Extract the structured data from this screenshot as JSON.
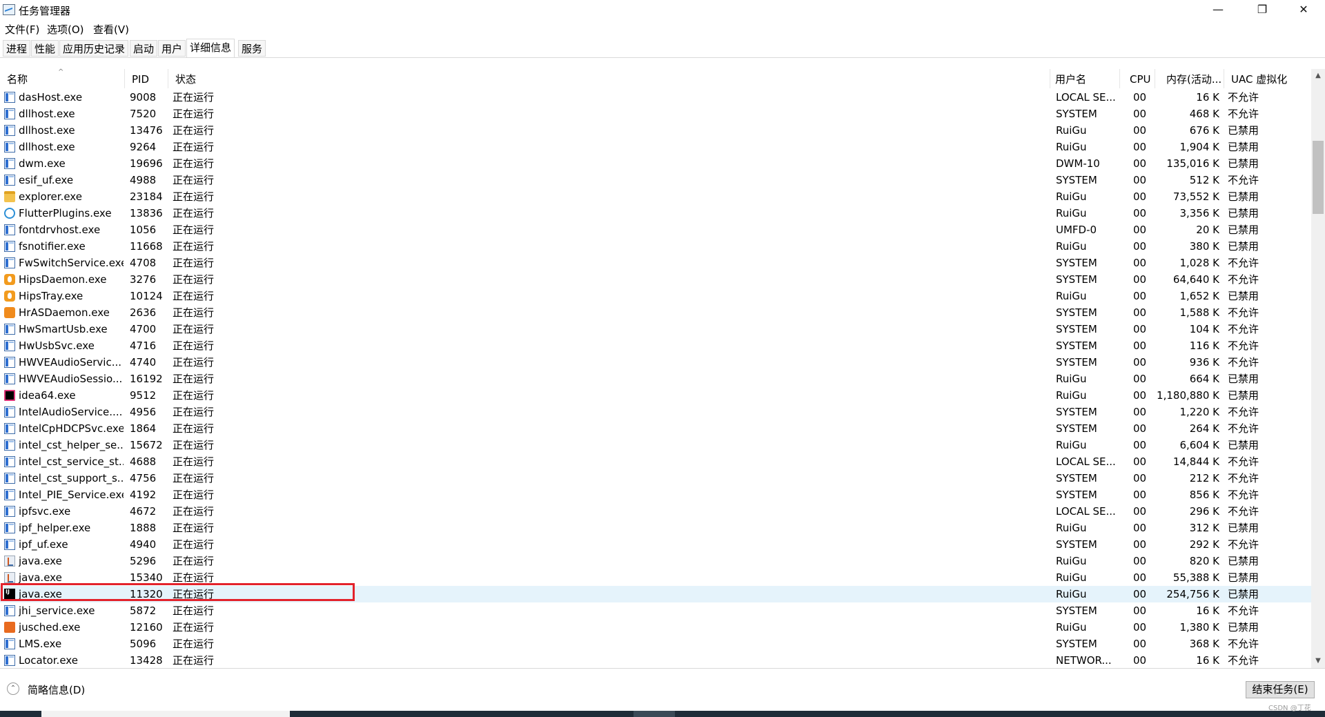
{
  "window": {
    "title": "任务管理器",
    "minimize": "—",
    "maximize": "❐",
    "close": "✕"
  },
  "menu": [
    "文件(F)",
    "选项(O)",
    "查看(V)"
  ],
  "tabs": [
    "进程",
    "性能",
    "应用历史记录",
    "启动",
    "用户",
    "详细信息",
    "服务"
  ],
  "active_tab": "详细信息",
  "columns": {
    "name": "名称",
    "pid": "PID",
    "status": "状态",
    "user": "用户名",
    "cpu": "CPU",
    "mem": "内存(活动...",
    "uac": "UAC 虚拟化"
  },
  "rows": [
    {
      "icon": "default",
      "name": "dasHost.exe",
      "pid": "9008",
      "status": "正在运行",
      "user": "LOCAL SE...",
      "cpu": "00",
      "mem": "16 K",
      "uac": "不允许"
    },
    {
      "icon": "default",
      "name": "dllhost.exe",
      "pid": "7520",
      "status": "正在运行",
      "user": "SYSTEM",
      "cpu": "00",
      "mem": "468 K",
      "uac": "不允许"
    },
    {
      "icon": "default",
      "name": "dllhost.exe",
      "pid": "13476",
      "status": "正在运行",
      "user": "RuiGu",
      "cpu": "00",
      "mem": "676 K",
      "uac": "已禁用"
    },
    {
      "icon": "default",
      "name": "dllhost.exe",
      "pid": "9264",
      "status": "正在运行",
      "user": "RuiGu",
      "cpu": "00",
      "mem": "1,904 K",
      "uac": "已禁用"
    },
    {
      "icon": "default",
      "name": "dwm.exe",
      "pid": "19696",
      "status": "正在运行",
      "user": "DWM-10",
      "cpu": "00",
      "mem": "135,016 K",
      "uac": "已禁用"
    },
    {
      "icon": "default",
      "name": "esif_uf.exe",
      "pid": "4988",
      "status": "正在运行",
      "user": "SYSTEM",
      "cpu": "00",
      "mem": "512 K",
      "uac": "不允许"
    },
    {
      "icon": "folder",
      "name": "explorer.exe",
      "pid": "23184",
      "status": "正在运行",
      "user": "RuiGu",
      "cpu": "00",
      "mem": "73,552 K",
      "uac": "已禁用"
    },
    {
      "icon": "flutter",
      "name": "FlutterPlugins.exe",
      "pid": "13836",
      "status": "正在运行",
      "user": "RuiGu",
      "cpu": "00",
      "mem": "3,356 K",
      "uac": "已禁用"
    },
    {
      "icon": "default",
      "name": "fontdrvhost.exe",
      "pid": "1056",
      "status": "正在运行",
      "user": "UMFD-0",
      "cpu": "00",
      "mem": "20 K",
      "uac": "已禁用"
    },
    {
      "icon": "default",
      "name": "fsnotifier.exe",
      "pid": "11668",
      "status": "正在运行",
      "user": "RuiGu",
      "cpu": "00",
      "mem": "380 K",
      "uac": "已禁用"
    },
    {
      "icon": "default",
      "name": "FwSwitchService.exe",
      "pid": "4708",
      "status": "正在运行",
      "user": "SYSTEM",
      "cpu": "00",
      "mem": "1,028 K",
      "uac": "不允许"
    },
    {
      "icon": "flame",
      "name": "HipsDaemon.exe",
      "pid": "3276",
      "status": "正在运行",
      "user": "SYSTEM",
      "cpu": "00",
      "mem": "64,640 K",
      "uac": "不允许"
    },
    {
      "icon": "flame",
      "name": "HipsTray.exe",
      "pid": "10124",
      "status": "正在运行",
      "user": "RuiGu",
      "cpu": "00",
      "mem": "1,652 K",
      "uac": "已禁用"
    },
    {
      "icon": "orange",
      "name": "HrASDaemon.exe",
      "pid": "2636",
      "status": "正在运行",
      "user": "SYSTEM",
      "cpu": "00",
      "mem": "1,588 K",
      "uac": "不允许"
    },
    {
      "icon": "default",
      "name": "HwSmartUsb.exe",
      "pid": "4700",
      "status": "正在运行",
      "user": "SYSTEM",
      "cpu": "00",
      "mem": "104 K",
      "uac": "不允许"
    },
    {
      "icon": "default",
      "name": "HwUsbSvc.exe",
      "pid": "4716",
      "status": "正在运行",
      "user": "SYSTEM",
      "cpu": "00",
      "mem": "116 K",
      "uac": "不允许"
    },
    {
      "icon": "default",
      "name": "HWVEAudioServic...",
      "pid": "4740",
      "status": "正在运行",
      "user": "SYSTEM",
      "cpu": "00",
      "mem": "936 K",
      "uac": "不允许"
    },
    {
      "icon": "default",
      "name": "HWVEAudioSessio...",
      "pid": "16192",
      "status": "正在运行",
      "user": "RuiGu",
      "cpu": "00",
      "mem": "664 K",
      "uac": "已禁用"
    },
    {
      "icon": "idea",
      "name": "idea64.exe",
      "pid": "9512",
      "status": "正在运行",
      "user": "RuiGu",
      "cpu": "00",
      "mem": "1,180,880 K",
      "uac": "已禁用"
    },
    {
      "icon": "default",
      "name": "IntelAudioService....",
      "pid": "4956",
      "status": "正在运行",
      "user": "SYSTEM",
      "cpu": "00",
      "mem": "1,220 K",
      "uac": "不允许"
    },
    {
      "icon": "default",
      "name": "IntelCpHDCPSvc.exe",
      "pid": "1864",
      "status": "正在运行",
      "user": "SYSTEM",
      "cpu": "00",
      "mem": "264 K",
      "uac": "不允许"
    },
    {
      "icon": "default",
      "name": "intel_cst_helper_se...",
      "pid": "15672",
      "status": "正在运行",
      "user": "RuiGu",
      "cpu": "00",
      "mem": "6,604 K",
      "uac": "已禁用"
    },
    {
      "icon": "default",
      "name": "intel_cst_service_st...",
      "pid": "4688",
      "status": "正在运行",
      "user": "LOCAL SE...",
      "cpu": "00",
      "mem": "14,844 K",
      "uac": "不允许"
    },
    {
      "icon": "default",
      "name": "intel_cst_support_s...",
      "pid": "4756",
      "status": "正在运行",
      "user": "SYSTEM",
      "cpu": "00",
      "mem": "212 K",
      "uac": "不允许"
    },
    {
      "icon": "default",
      "name": "Intel_PIE_Service.exe",
      "pid": "4192",
      "status": "正在运行",
      "user": "SYSTEM",
      "cpu": "00",
      "mem": "856 K",
      "uac": "不允许"
    },
    {
      "icon": "default",
      "name": "ipfsvc.exe",
      "pid": "4672",
      "status": "正在运行",
      "user": "LOCAL SE...",
      "cpu": "00",
      "mem": "296 K",
      "uac": "不允许"
    },
    {
      "icon": "default",
      "name": "ipf_helper.exe",
      "pid": "1888",
      "status": "正在运行",
      "user": "RuiGu",
      "cpu": "00",
      "mem": "312 K",
      "uac": "已禁用"
    },
    {
      "icon": "default",
      "name": "ipf_uf.exe",
      "pid": "4940",
      "status": "正在运行",
      "user": "SYSTEM",
      "cpu": "00",
      "mem": "292 K",
      "uac": "不允许"
    },
    {
      "icon": "java",
      "name": "java.exe",
      "pid": "5296",
      "status": "正在运行",
      "user": "RuiGu",
      "cpu": "00",
      "mem": "820 K",
      "uac": "已禁用"
    },
    {
      "icon": "java",
      "name": "java.exe",
      "pid": "15340",
      "status": "正在运行",
      "user": "RuiGu",
      "cpu": "00",
      "mem": "55,388 K",
      "uac": "已禁用"
    },
    {
      "icon": "intellij",
      "name": "java.exe",
      "pid": "11320",
      "status": "正在运行",
      "user": "RuiGu",
      "cpu": "00",
      "mem": "254,756 K",
      "uac": "已禁用",
      "selected": true
    },
    {
      "icon": "default",
      "name": "jhi_service.exe",
      "pid": "5872",
      "status": "正在运行",
      "user": "SYSTEM",
      "cpu": "00",
      "mem": "16 K",
      "uac": "不允许"
    },
    {
      "icon": "jusched",
      "name": "jusched.exe",
      "pid": "12160",
      "status": "正在运行",
      "user": "RuiGu",
      "cpu": "00",
      "mem": "1,380 K",
      "uac": "已禁用"
    },
    {
      "icon": "default",
      "name": "LMS.exe",
      "pid": "5096",
      "status": "正在运行",
      "user": "SYSTEM",
      "cpu": "00",
      "mem": "368 K",
      "uac": "不允许"
    },
    {
      "icon": "default",
      "name": "Locator.exe",
      "pid": "13428",
      "status": "正在运行",
      "user": "NETWOR...",
      "cpu": "00",
      "mem": "16 K",
      "uac": "不允许"
    }
  ],
  "footer": {
    "brief_label": "简略信息(D)",
    "end_task_label": "结束任务(E)"
  },
  "watermark": "CSDN @丁花",
  "colors": {
    "selected_row": "#e5f3fb",
    "highlight_box": "#e3222b"
  }
}
